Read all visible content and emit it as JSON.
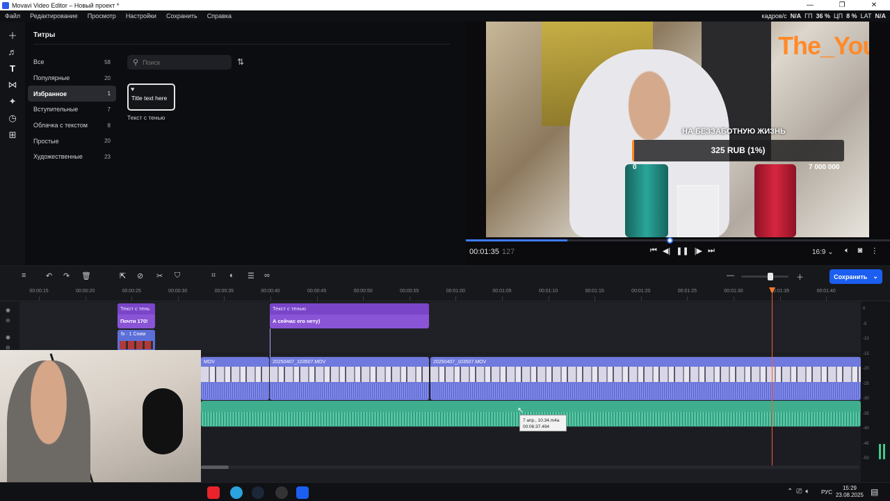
{
  "window": {
    "title": "Movavi Video Editor – Новый проект *",
    "minimize": "—",
    "maximize": "❐",
    "close": "✕"
  },
  "menu": [
    "Файл",
    "Редактирование",
    "Просмотр",
    "Настройки",
    "Сохранить",
    "Справка"
  ],
  "stats": {
    "fps_label": "кадров/с",
    "fps_value": "N/A",
    "gpu_label": "ГП",
    "gpu_value": "36 %",
    "cpu_label": "ЦП",
    "cpu_value": "8 %",
    "lat_label": "LAT",
    "lat_value": "N/A"
  },
  "toolrail": [
    "plus-icon",
    "music-icon",
    "text-icon",
    "transitions-icon",
    "magic-icon",
    "clock-icon",
    "grid-icon"
  ],
  "library": {
    "title": "Титры",
    "categories": [
      {
        "label": "Все",
        "count": "58"
      },
      {
        "label": "Популярные",
        "count": "20"
      },
      {
        "label": "Избранное",
        "count": "1",
        "selected": true
      },
      {
        "label": "Вступительные",
        "count": "7"
      },
      {
        "label": "Облачка с текстом",
        "count": "8"
      },
      {
        "label": "Простые",
        "count": "20"
      },
      {
        "label": "Художественные",
        "count": "23"
      }
    ],
    "search_placeholder": "Поиск",
    "tile_text": "Title text here",
    "tile_label": "Текст с тенью"
  },
  "preview": {
    "overlay_brand": "The_Your_",
    "donate_title": "НА БЕЗЗАБОТНУЮ ЖИЗНЬ",
    "donate_amount": "325 RUB (1%)",
    "donate_progress": 0.01,
    "donate_min": "0",
    "donate_max": "7 000 000",
    "timecode": "00:01:35",
    "frames": "127",
    "position": 0.24,
    "ratio": "16:9 ⌄"
  },
  "timeline": {
    "save_label": "Сохранить",
    "ruler": [
      "00:00:15",
      "00:00:20",
      "00:00:25",
      "00:00:30",
      "00:00:35",
      "00:00:40",
      "00:00:45",
      "00:00:50",
      "00:00:55",
      "00:01:00",
      "00:01:05",
      "00:01:10",
      "00:01:15",
      "00:01:20",
      "00:01:25",
      "00:01:30",
      "00:01:35",
      "00:01:40"
    ],
    "title_clips": [
      {
        "head": "Текст с тень",
        "body": "Почти 170!"
      },
      {
        "head": "Текст с тенью",
        "body": "А сейчас его нету)"
      }
    ],
    "fx_clip": "fx · 1  Сним",
    "video_clips": [
      "MOV",
      "20250407_103507.MOV",
      "20250407_103507.MOV"
    ],
    "tooltip_line1": "7 апр., 10.34.m4a",
    "tooltip_line2": "00:06:37.494",
    "meter_labels": [
      "0",
      "-5",
      "-10",
      "-15",
      "-20",
      "-25",
      "-30",
      "-35",
      "-40",
      "-45",
      "-50"
    ]
  },
  "taskbar": {
    "lang": "РУС",
    "time": "15:29",
    "date": "23.08.2025"
  }
}
